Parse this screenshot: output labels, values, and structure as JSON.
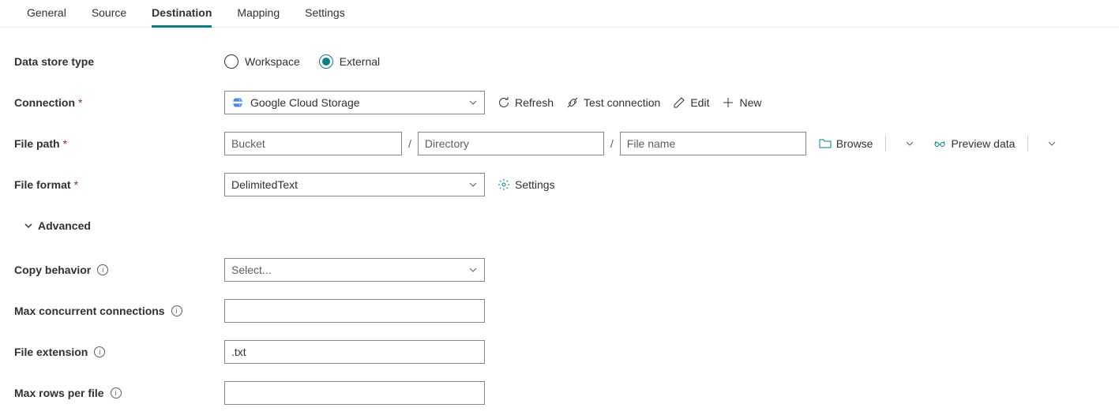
{
  "tabs": {
    "general": "General",
    "source": "Source",
    "destination": "Destination",
    "mapping": "Mapping",
    "settings": "Settings",
    "active": "destination"
  },
  "labels": {
    "dataStoreType": "Data store type",
    "connection": "Connection",
    "filePath": "File path",
    "fileFormat": "File format",
    "advanced": "Advanced",
    "copyBehavior": "Copy behavior",
    "maxConcurrentConnections": "Max concurrent connections",
    "fileExtension": "File extension",
    "maxRowsPerFile": "Max rows per file"
  },
  "dataStoreType": {
    "workspace": "Workspace",
    "external": "External",
    "selected": "external"
  },
  "connection": {
    "value": "Google Cloud Storage",
    "actions": {
      "refresh": "Refresh",
      "testConnection": "Test connection",
      "edit": "Edit",
      "new": "New"
    }
  },
  "filePath": {
    "bucketPlaceholder": "Bucket",
    "directoryPlaceholder": "Directory",
    "fileNamePlaceholder": "File name",
    "bucketValue": "",
    "directoryValue": "",
    "fileNameValue": "",
    "actions": {
      "browse": "Browse",
      "previewData": "Preview data"
    }
  },
  "fileFormat": {
    "value": "DelimitedText",
    "settingsLabel": "Settings"
  },
  "copyBehavior": {
    "placeholder": "Select..."
  },
  "maxConcurrentConnections": {
    "value": ""
  },
  "fileExtension": {
    "value": ".txt"
  },
  "maxRowsPerFile": {
    "value": ""
  }
}
